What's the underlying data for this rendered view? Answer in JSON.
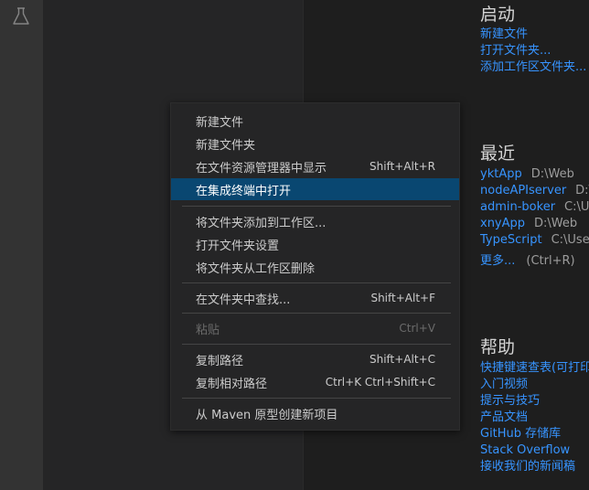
{
  "activity_bar": {
    "icon": "flask-icon"
  },
  "welcome": {
    "start": {
      "title": "启动",
      "links": [
        "新建文件",
        "打开文件夹...",
        "添加工作区文件夹..."
      ]
    },
    "recent": {
      "title": "最近",
      "items": [
        {
          "name": "yktApp",
          "path": "D:\\Web"
        },
        {
          "name": "nodeAPIserver",
          "path": "D:\\g"
        },
        {
          "name": "admin-boker",
          "path": "C:\\Us"
        },
        {
          "name": "xnyApp",
          "path": "D:\\Web"
        },
        {
          "name": "TypeScript",
          "path": "C:\\Users"
        }
      ],
      "more": "更多...",
      "more_hint": "(Ctrl+R)"
    },
    "help": {
      "title": "帮助",
      "links": [
        "快捷键速查表(可打印)",
        "入门视频",
        "提示与技巧",
        "产品文档",
        "GitHub 存储库",
        "Stack Overflow",
        "接收我们的新闻稿"
      ]
    }
  },
  "context_menu": {
    "items": [
      {
        "label": "新建文件",
        "shortcut": ""
      },
      {
        "label": "新建文件夹",
        "shortcut": ""
      },
      {
        "label": "在文件资源管理器中显示",
        "shortcut": "Shift+Alt+R"
      },
      {
        "label": "在集成终端中打开",
        "shortcut": "",
        "active": true
      },
      {
        "label": "将文件夹添加到工作区...",
        "shortcut": ""
      },
      {
        "label": "打开文件夹设置",
        "shortcut": ""
      },
      {
        "label": "将文件夹从工作区删除",
        "shortcut": ""
      },
      {
        "label": "在文件夹中查找...",
        "shortcut": "Shift+Alt+F"
      },
      {
        "label": "粘贴",
        "shortcut": "Ctrl+V",
        "disabled": true
      },
      {
        "label": "复制路径",
        "shortcut": "Shift+Alt+C"
      },
      {
        "label": "复制相对路径",
        "shortcut": "Ctrl+K Ctrl+Shift+C"
      },
      {
        "label": "从 Maven 原型创建新项目",
        "shortcut": ""
      }
    ]
  },
  "colors": {
    "accent": "#3794ff",
    "selection": "#094771"
  }
}
